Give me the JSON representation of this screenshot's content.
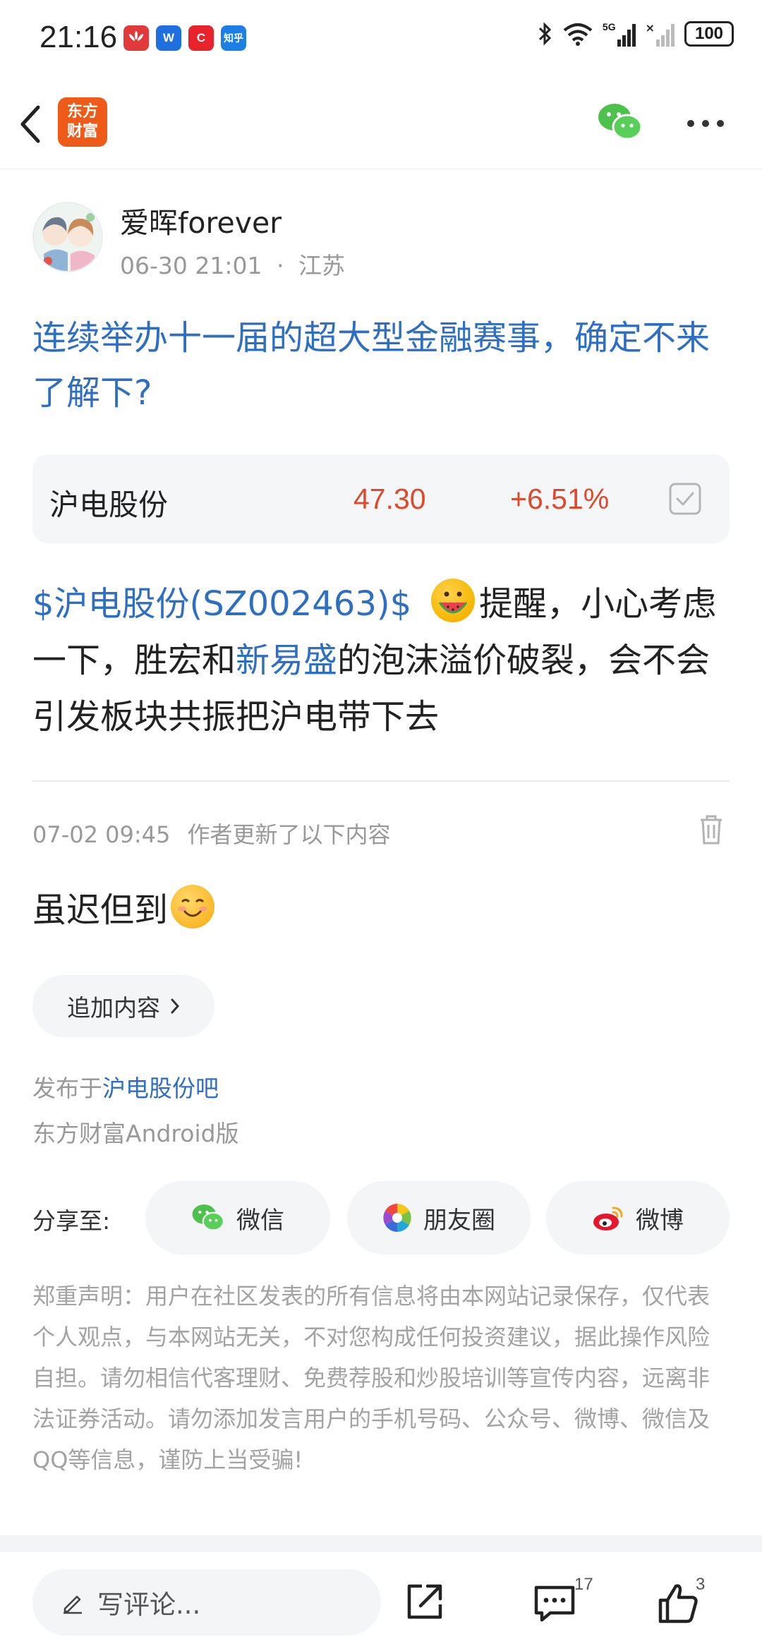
{
  "status_bar": {
    "time": "21:16",
    "apps": [
      {
        "name": "huawei",
        "label": "",
        "color": "#e23a3a"
      },
      {
        "name": "w-app",
        "label": "W",
        "color": "#1e6fe0"
      },
      {
        "name": "c-app",
        "label": "C",
        "color": "#e8232c"
      },
      {
        "name": "zhihu",
        "label": "知乎",
        "color": "#1b7fe5"
      }
    ],
    "network": "5G",
    "battery": "100"
  },
  "nav": {
    "brand_line1": "东方",
    "brand_line2": "财富"
  },
  "post": {
    "author": "爱晖forever",
    "date": "06-30 21:01",
    "sep": "·",
    "location": "江苏",
    "title": "连续举办十一届的超大型金融赛事，确定不来了解下?",
    "stock": {
      "name": "沪电股份",
      "price": "47.30",
      "change": "+6.51%"
    },
    "body": {
      "stock_link": "$沪电股份(SZ002463)$",
      "text_1": "提醒，小心考虑一下，胜宏和",
      "link_2": "新易盛",
      "text_2": "的泡沫溢价破裂，会不会引发板块共振把沪电带下去"
    },
    "update_time": "07-02 09:45",
    "update_label": "作者更新了以下内容",
    "update_text": "虽迟但到",
    "add_button": "追加内容",
    "posted_in_prefix": "发布于",
    "posted_in_bar": "沪电股份吧",
    "client": "东方财富Android版"
  },
  "share": {
    "label": "分享至:",
    "wechat": "微信",
    "moments": "朋友圈",
    "weibo": "微博"
  },
  "disclaimer": "郑重声明：用户在社区发表的所有信息将由本网站记录保存，仅代表个人观点，与本网站无关，不对您构成任何投资建议，据此操作风险自担。请勿相信代客理财、免费荐股和炒股培训等宣传内容，远离非法证券活动。请勿添加发言用户的手机号码、公众号、微博、微信及QQ等信息，谨防上当受骗!",
  "bottom_bar": {
    "comment_placeholder": "写评论...",
    "comment_count": "17",
    "like_count": "3"
  },
  "colors": {
    "accent_blue": "#2f6fc2",
    "price_red": "#e0482b",
    "brand_orange": "#ee5a18"
  }
}
